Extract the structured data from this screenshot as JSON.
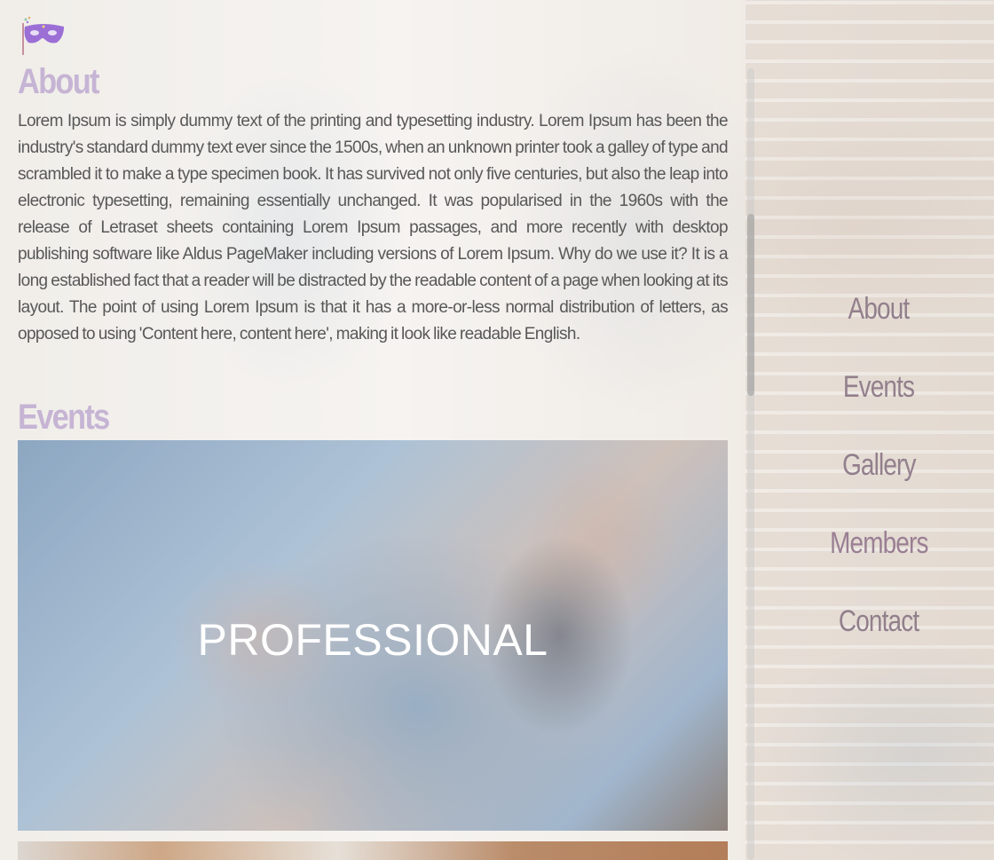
{
  "brand": {
    "logo_icon": "masquerade-mask-icon",
    "accent_color": "#9b6fd6"
  },
  "about": {
    "title": "About",
    "body": "Lorem Ipsum is simply dummy text of the printing and typesetting industry. Lorem Ipsum has been the industry's standard dummy text ever since the 1500s, when an unknown printer took a galley of type and scrambled it to make a type specimen book. It has survived not only five centuries, but also the leap into electronic typesetting, remaining essentially unchanged. It was popularised in the 1960s with the release of Letraset sheets containing Lorem Ipsum passages, and more recently with desktop publishing software like Aldus PageMaker including versions of Lorem Ipsum. Why do we use it? It is a long established fact that a reader will be distracted by the readable content of a page when looking at its layout. The point of using Lorem Ipsum is that it has a more-or-less normal distribution of letters, as opposed to using 'Content here, content here', making it look like readable English."
  },
  "events": {
    "title": "Events",
    "cards": [
      {
        "label": "PROFESSIONAL"
      }
    ]
  },
  "nav": {
    "items": [
      {
        "label": "About"
      },
      {
        "label": "Events"
      },
      {
        "label": "Gallery"
      },
      {
        "label": "Members"
      },
      {
        "label": "Contact"
      }
    ]
  },
  "colors": {
    "section_title": "#c6b4d4",
    "nav_text": "#9a7f93",
    "body_text": "#585858"
  }
}
